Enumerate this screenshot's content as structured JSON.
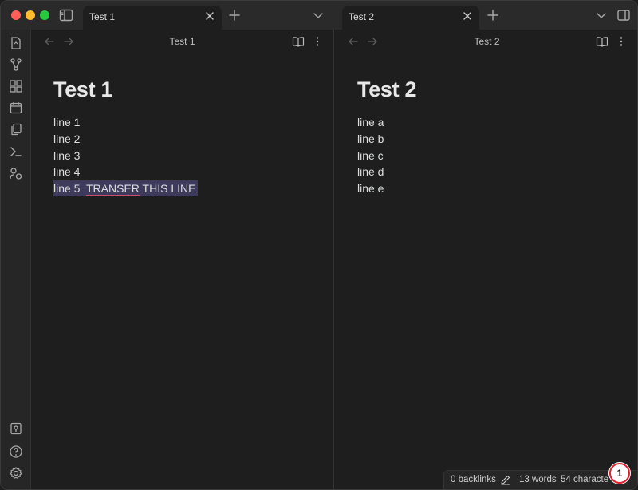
{
  "tabs": [
    {
      "label": "Test 1"
    },
    {
      "label": "Test 2"
    }
  ],
  "left_pane": {
    "header_title": "Test 1",
    "doc_title": "Test 1",
    "lines": [
      "line 1",
      "line 2",
      "line 3",
      "line 4"
    ],
    "selected_line_prefix": "line 5  ",
    "selected_line_misspelled": "TRANSER",
    "selected_line_suffix": " THIS LINE"
  },
  "right_pane": {
    "header_title": "Test 2",
    "doc_title": "Test 2",
    "lines": [
      "line a",
      "line b",
      "line c",
      "line d",
      "line e"
    ]
  },
  "status": {
    "backlinks": "0 backlinks",
    "words": "13 words",
    "characters": "54 characte"
  },
  "badge": "1",
  "colors": {
    "background": "#1e1e1e",
    "selection": "#3e3a5c",
    "spellcheck_underline": "#d14b6c",
    "badge_border": "#e0202a"
  },
  "icons": [
    "sidebar-toggle-icon",
    "close-icon",
    "plus-icon",
    "chevron-down-icon",
    "right-sidebar-icon",
    "files-icon",
    "graph-icon",
    "canvas-icon",
    "calendar-icon",
    "copy-icon",
    "terminal-icon",
    "people-icon",
    "vault-icon",
    "help-icon",
    "settings-icon",
    "arrow-left-icon",
    "arrow-right-icon",
    "book-icon",
    "more-icon",
    "pencil-icon"
  ]
}
